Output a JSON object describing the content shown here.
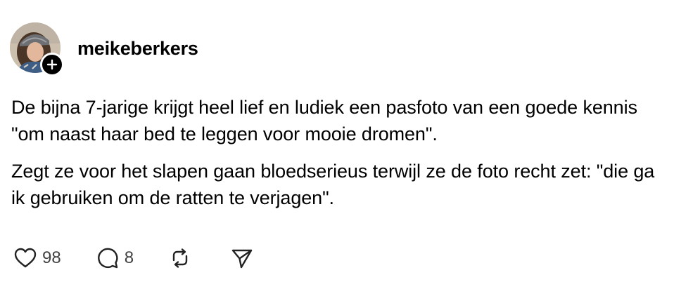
{
  "post": {
    "username": "meikeberkers",
    "paragraphs": [
      "De bijna 7-jarige krijgt heel lief en ludiek een pasfoto van een goede kennis \"om naast haar bed te leggen voor mooie dromen\".",
      "Zegt ze voor het slapen gaan bloedserieus terwijl ze de foto recht zet: \"die ga ik gebruiken om de ratten te verjagen\"."
    ]
  },
  "actions": {
    "likes": "98",
    "replies": "8"
  },
  "icons": {
    "follow": "plus-icon",
    "like": "heart-icon",
    "reply": "speech-bubble-icon",
    "repost": "repost-icon",
    "share": "send-icon"
  },
  "colors": {
    "text": "#000000",
    "muted": "#424242",
    "badge": "#000000"
  }
}
